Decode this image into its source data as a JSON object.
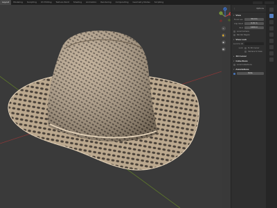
{
  "workspace_tabs": [
    {
      "label": "Layout",
      "active": true
    },
    {
      "label": "Modeling",
      "active": false
    },
    {
      "label": "Sculpting",
      "active": false
    },
    {
      "label": "UV Editing",
      "active": false
    },
    {
      "label": "Texture Paint",
      "active": false
    },
    {
      "label": "Shading",
      "active": false
    },
    {
      "label": "Animation",
      "active": false
    },
    {
      "label": "Rendering",
      "active": false
    },
    {
      "label": "Compositing",
      "active": false
    },
    {
      "label": "Geometry Nodes",
      "active": false
    },
    {
      "label": "Scripting",
      "active": false
    }
  ],
  "colors": {
    "viewport_bg": "#3a3a3a",
    "straw": "#c9b59c",
    "straw_dark": "#7d6b55",
    "axis_x": "#9b3a3a",
    "axis_y": "#6f8a2e",
    "accent": "#4772b3"
  },
  "gizmo": {
    "x_label": "X",
    "y_label": "Y",
    "z_label": "Z"
  },
  "viewport_tools": [
    "zoom-icon",
    "hand-pan-icon",
    "camera-icon",
    "grid-icon"
  ],
  "panel": {
    "header_label": "Options",
    "view_section": "View",
    "focal_length_label": "Focal Len",
    "focal_length_value": "50 mm",
    "clip_start_label": "Clip Start",
    "clip_start_value": "0.01 m",
    "clip_end_label": "End",
    "clip_end_value": "1000 m",
    "local_camera_label": "Local Camera",
    "render_region_label": "Render Region",
    "view_lock_section": "View Lock",
    "lock_to_object_label": "Lock to Object",
    "lock_label": "Lock",
    "to_3d_cursor_label": "To 3D Cursor",
    "camera_to_view_label": "Camera to View",
    "cursor_section": "3D Cursor",
    "collections_section": "Collections",
    "local_collections_label": "Local Collections",
    "annotations_section": "Annotations",
    "annotation_value": "Note"
  }
}
